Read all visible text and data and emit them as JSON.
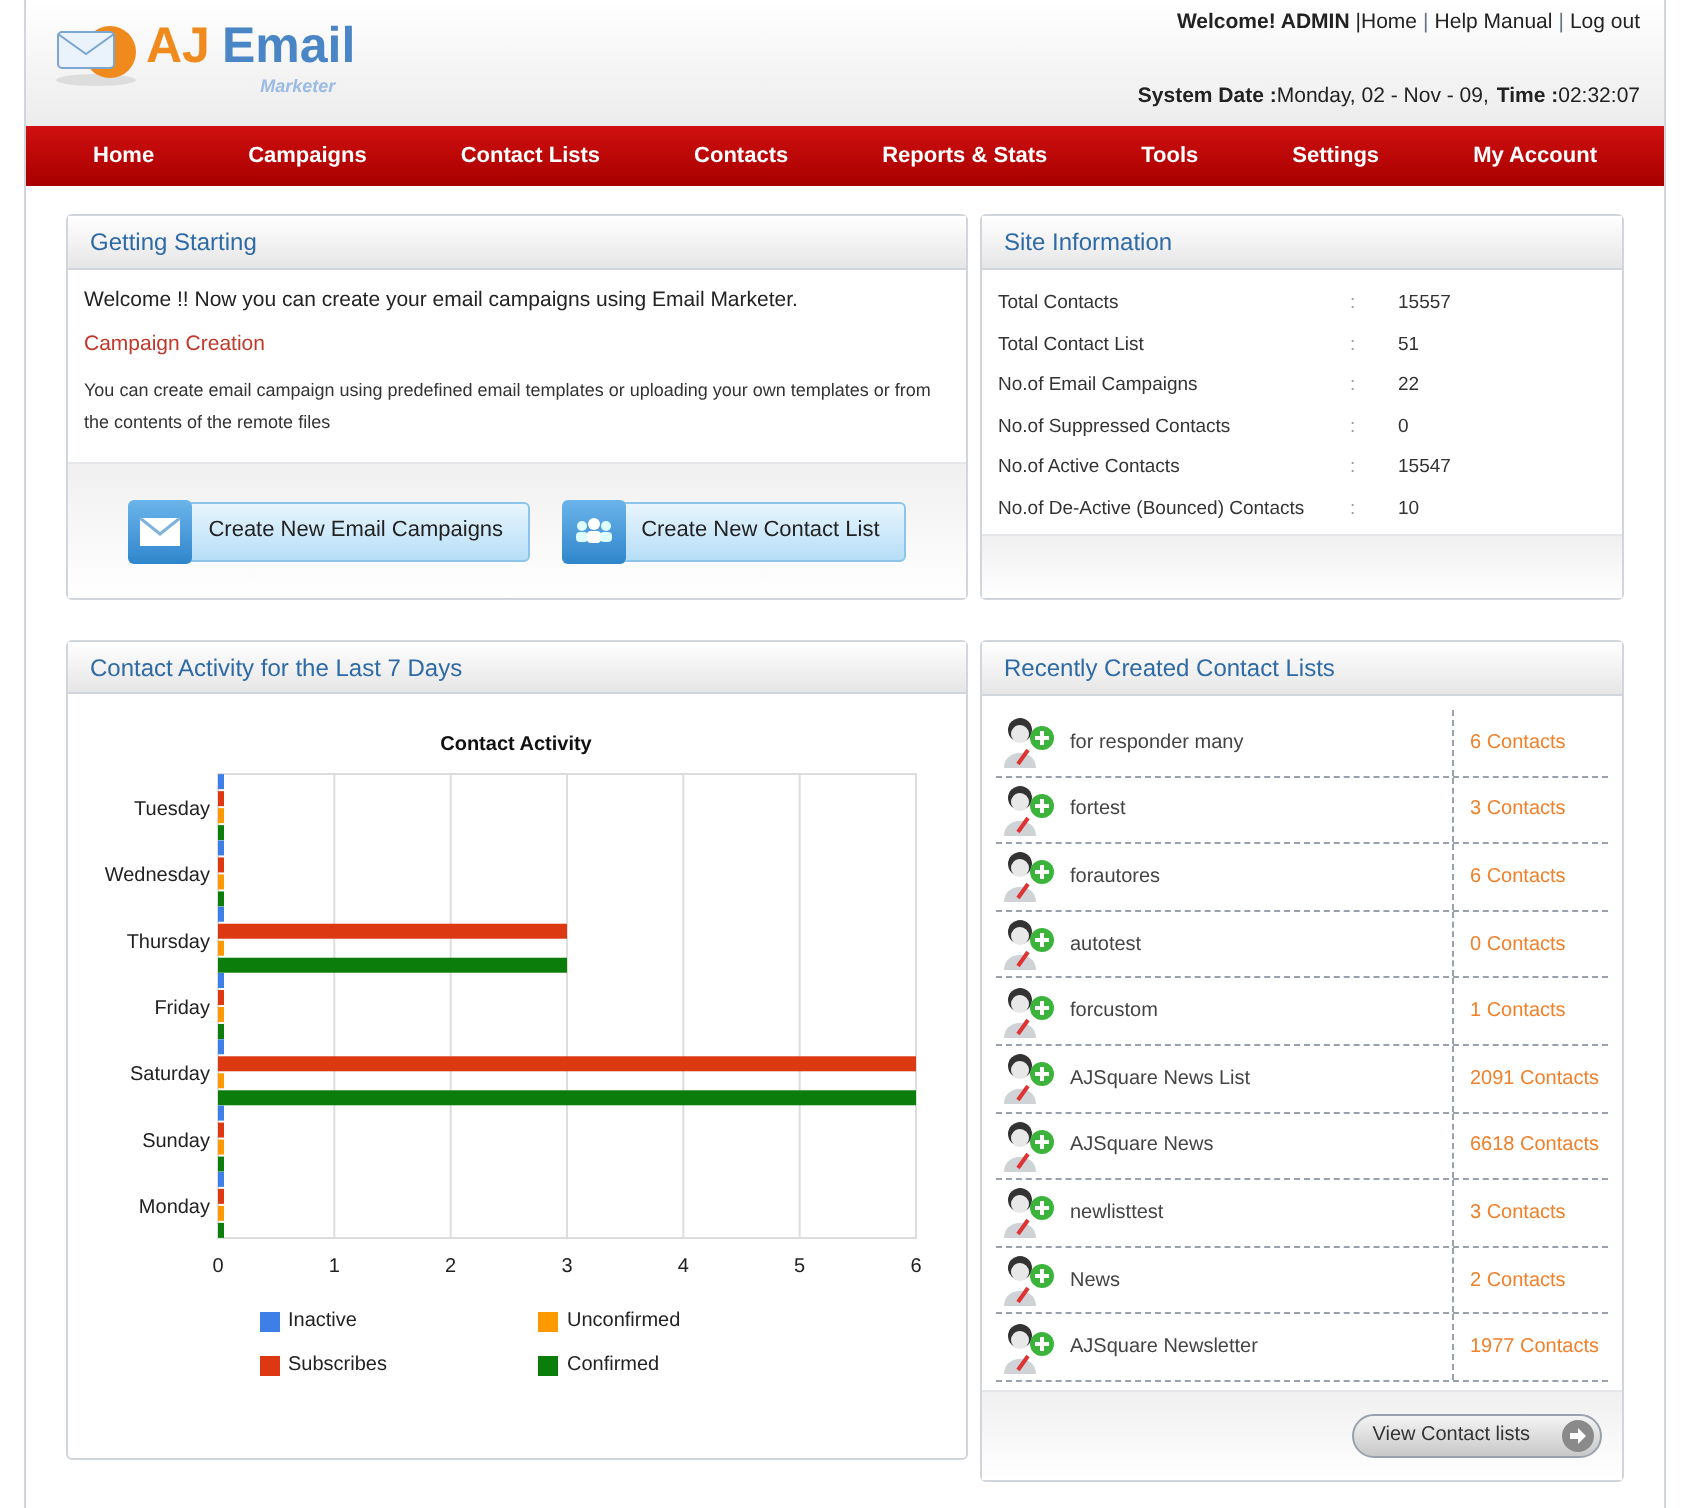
{
  "logo": {
    "title_part_1": "AJ",
    "title_part_2": "Email",
    "subtitle": "Marketer"
  },
  "header": {
    "welcome": "Welcome! ADMIN",
    "links": [
      "|Home",
      "|",
      "Help Manual",
      "|",
      "Log out"
    ],
    "system_date_label": "System Date :",
    "system_date": "Monday, 02 - Nov - 09,",
    "time_label": "Time :",
    "time": "02:32:07"
  },
  "nav": [
    "Home",
    "Campaigns",
    "Contact Lists",
    "Contacts",
    "Reports & Stats",
    "Tools",
    "Settings",
    "My Account"
  ],
  "getting_started": {
    "title": "Getting Starting",
    "welcome": "Welcome !! Now you can create your email campaigns using Email Marketer.",
    "subheading": "Campaign Creation",
    "description": "You can create email campaign using predefined email templates or uploading your own templates or from the contents of the remote files",
    "buttons": [
      {
        "label": "Create New Email Campaigns",
        "kind": "email"
      },
      {
        "label": "Create New Contact List",
        "kind": "contacts"
      }
    ]
  },
  "site_information": {
    "title": "Site Information",
    "rows": [
      {
        "label": "Total Contacts",
        "sep": ":",
        "value": "15557"
      },
      {
        "label": "Total Contact List",
        "sep": ":",
        "value": "51"
      },
      {
        "label": "No.of Email Campaigns",
        "sep": ":",
        "value": "22"
      },
      {
        "label": "No.of Suppressed Contacts",
        "sep": ":",
        "value": "0"
      },
      {
        "label": "No.of Active Contacts",
        "sep": ":",
        "value": "15547"
      },
      {
        "label": "No.of De-Active (Bounced) Contacts",
        "sep": ":",
        "value": "10"
      }
    ]
  },
  "contact_activity": {
    "title": "Contact Activity for the Last 7 Days",
    "chart_data": {
      "type": "bar",
      "orientation": "horizontal",
      "title": "Contact Activity",
      "categories": [
        "Tuesday",
        "Wednesday",
        "Thursday",
        "Friday",
        "Saturday",
        "Sunday",
        "Monday"
      ],
      "series": [
        {
          "name": "Inactive",
          "color": "#3d7fe6",
          "values": [
            0,
            0,
            0,
            0,
            0,
            0,
            0
          ]
        },
        {
          "name": "Subscribes",
          "color": "#dc3912",
          "values": [
            0,
            0,
            3,
            0,
            6,
            0,
            0
          ]
        },
        {
          "name": "Unconfirmed",
          "color": "#ff9900",
          "values": [
            0,
            0,
            0,
            0,
            0,
            0,
            0
          ]
        },
        {
          "name": "Confirmed",
          "color": "#0a7d0a",
          "values": [
            0,
            0,
            3,
            0,
            6,
            0,
            0
          ]
        }
      ],
      "xlim": [
        0,
        6
      ],
      "xticks": [
        0,
        1,
        2,
        3,
        4,
        5,
        6
      ],
      "grid": true,
      "legend": "bottom"
    }
  },
  "recent_contact_lists": {
    "title": "Recently Created Contact Lists",
    "rows": [
      {
        "name": "for responder many",
        "count": "6 Contacts"
      },
      {
        "name": "fortest",
        "count": "3 Contacts"
      },
      {
        "name": "forautores",
        "count": "6 Contacts"
      },
      {
        "name": "autotest",
        "count": "0 Contacts"
      },
      {
        "name": "forcustom",
        "count": "1 Contacts"
      },
      {
        "name": "AJSquare News List",
        "count": "2091 Contacts"
      },
      {
        "name": "AJSquare News",
        "count": "6618 Contacts"
      },
      {
        "name": "newlisttest",
        "count": "3 Contacts"
      },
      {
        "name": "News",
        "count": "2 Contacts"
      },
      {
        "name": "AJSquare Newsletter",
        "count": "1977 Contacts"
      }
    ],
    "button": "View Contact lists"
  }
}
